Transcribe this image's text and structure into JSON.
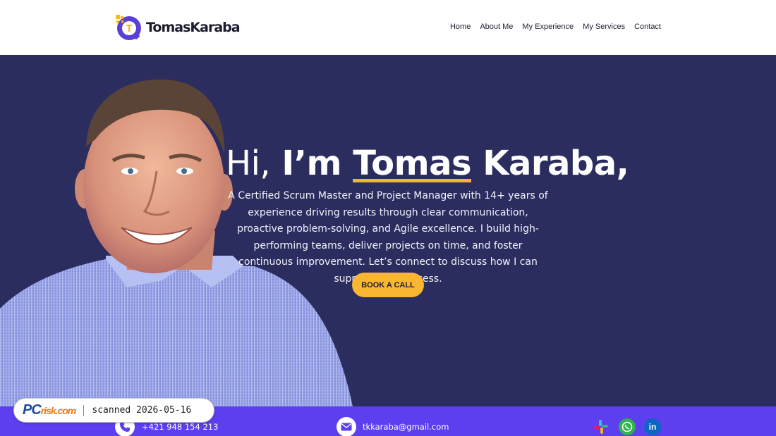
{
  "brand": {
    "name": "TomasKaraba",
    "logo_letter": "T"
  },
  "nav": {
    "items": [
      "Home",
      "About Me",
      "My Experience",
      "My Services",
      "Contact"
    ]
  },
  "hero": {
    "greeting": "Hi,",
    "im": "I’m",
    "first_name": "Tomas",
    "last_name": "Karaba,",
    "description": "A Certified Scrum Master and Project Manager with 14+ years of experience driving results through clear communication, proactive problem-solving, and Agile excellence. I build high-performing teams, deliver projects on time, and foster continuous improvement. Let’s connect to discuss how I can support your success.",
    "cta_label": "BOOK A CALL"
  },
  "contact": {
    "phone": "+421 948 154 213",
    "email": "tkkaraba@gmail.com",
    "socials": [
      "slack-icon",
      "whatsapp-icon",
      "linkedin-icon"
    ]
  },
  "watermark": {
    "logo_main": "PC",
    "logo_sub": "risk.com",
    "text": "scanned 2026-05-16"
  },
  "colors": {
    "hero_bg": "#2b2d5f",
    "accent": "#f8b632",
    "contact_bar": "#5e3ff0",
    "logo_purple": "#5b3fd6"
  }
}
